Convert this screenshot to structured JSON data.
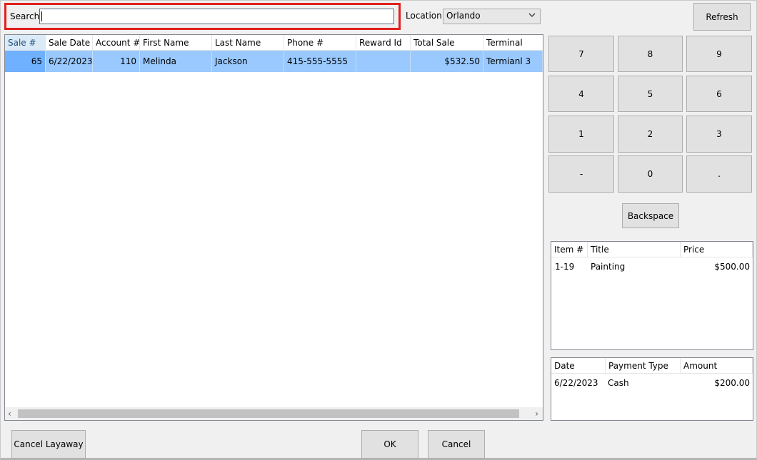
{
  "search": {
    "label": "Search",
    "value": ""
  },
  "location": {
    "label": "Location",
    "selected": "Orlando"
  },
  "buttons": {
    "refresh": "Refresh",
    "backspace": "Backspace",
    "cancel_layaway": "Cancel Layaway",
    "ok": "OK",
    "cancel": "Cancel"
  },
  "keypad": [
    "7",
    "8",
    "9",
    "4",
    "5",
    "6",
    "1",
    "2",
    "3",
    "-",
    "0",
    "."
  ],
  "sales_grid": {
    "columns": [
      "Sale #",
      "Sale Date",
      "Account #",
      "First Name",
      "Last Name",
      "Phone #",
      "Reward Id",
      "Total Sale",
      "Terminal"
    ],
    "rows": [
      [
        "65",
        "6/22/2023",
        "110",
        "Melinda",
        "Jackson",
        "415-555-5555",
        "",
        "$532.50",
        "Termianl 3"
      ]
    ]
  },
  "items_grid": {
    "columns": [
      "Item #",
      "Title",
      "Price"
    ],
    "rows": [
      [
        "1-19",
        "Painting",
        "$500.00"
      ]
    ]
  },
  "payments_grid": {
    "columns": [
      "Date",
      "Payment Type",
      "Amount"
    ],
    "rows": [
      [
        "6/22/2023",
        "Cash",
        "$200.00"
      ]
    ]
  },
  "scroll": {
    "left_arrow": "‹",
    "right_arrow": "›"
  },
  "colors": {
    "search_highlight": "#e0201d",
    "selected_row": "#99c9ff"
  }
}
